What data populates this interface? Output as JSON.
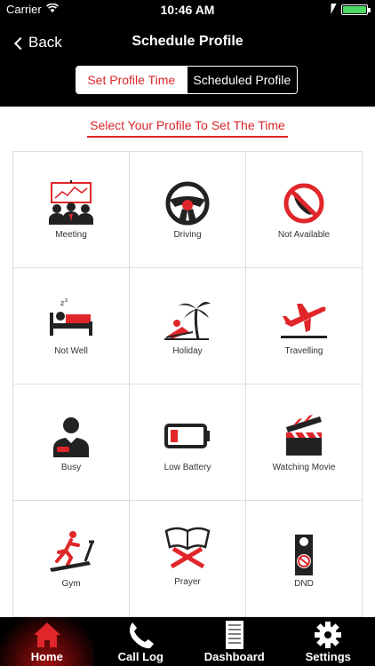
{
  "status": {
    "carrier": "Carrier",
    "time": "10:46 AM"
  },
  "nav": {
    "back_label": "Back",
    "title": "Schedule Profile"
  },
  "segments": {
    "set_time": "Set Profile Time",
    "scheduled": "Scheduled Profile"
  },
  "prompt": "Select Your Profile To Set The Time",
  "profiles": [
    {
      "label": "Meeting",
      "icon": "meeting-icon"
    },
    {
      "label": "Driving",
      "icon": "steering-wheel-icon"
    },
    {
      "label": "Not Available",
      "icon": "no-phone-icon"
    },
    {
      "label": "Not Well",
      "icon": "sick-bed-icon"
    },
    {
      "label": "Holiday",
      "icon": "palm-tree-icon"
    },
    {
      "label": "Travelling",
      "icon": "airplane-icon"
    },
    {
      "label": "Busy",
      "icon": "busy-person-icon"
    },
    {
      "label": "Low Battery",
      "icon": "low-battery-icon"
    },
    {
      "label": "Watching Movie",
      "icon": "clapperboard-icon"
    },
    {
      "label": "Gym",
      "icon": "treadmill-icon"
    },
    {
      "label": "Prayer",
      "icon": "book-stand-icon"
    },
    {
      "label": "DND",
      "icon": "door-hanger-icon"
    }
  ],
  "tabs": [
    {
      "label": "Home",
      "icon": "home-icon"
    },
    {
      "label": "Call Log",
      "icon": "phone-icon"
    },
    {
      "label": "Dashboard",
      "icon": "document-icon"
    },
    {
      "label": "Settings",
      "icon": "gear-icon"
    }
  ],
  "colors": {
    "accent": "#e0262a",
    "dark": "#222222",
    "bar": "#000000"
  }
}
